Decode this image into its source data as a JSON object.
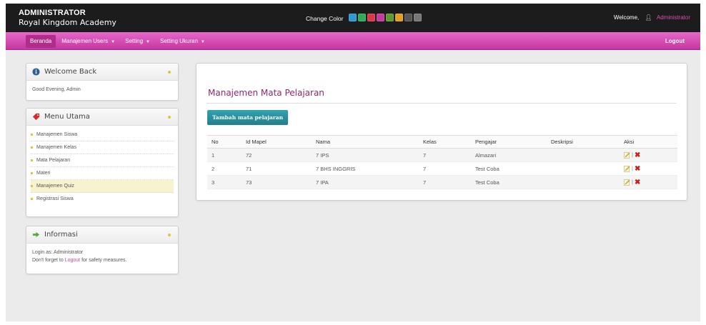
{
  "header": {
    "role": "ADMINISTRATOR",
    "school": "Royal Kingdom Academy",
    "change_color_label": "Change Color",
    "swatches": [
      "#2f9bd4",
      "#2fa95a",
      "#d93a4a",
      "#c53ba0",
      "#5e9a2f",
      "#e1a020",
      "#555555",
      "#777777"
    ],
    "welcome_label": "Welcome,",
    "user_name": "Administrator",
    "user_icon": "user-icon"
  },
  "nav": {
    "items": [
      {
        "label": "Beranda",
        "active": true,
        "dropdown": false
      },
      {
        "label": "Manajemen Users",
        "active": false,
        "dropdown": true
      },
      {
        "label": "Setting",
        "active": false,
        "dropdown": true
      },
      {
        "label": "Setting Ukuran",
        "active": false,
        "dropdown": true
      }
    ],
    "logout": "Logout"
  },
  "sidebar": {
    "welcome": {
      "title": "Welcome Back",
      "icon": "info-icon",
      "text": "Good Evening, Admin"
    },
    "menu": {
      "title": "Menu Utama",
      "icon": "tag-icon",
      "items": [
        {
          "label": "Manajemen Siswa"
        },
        {
          "label": "Manajemen Kelas"
        },
        {
          "label": "Mata Pelajaran"
        },
        {
          "label": "Materi"
        },
        {
          "label": "Manajemen Quiz"
        },
        {
          "label": "Registrasi Siswa"
        }
      ]
    },
    "info": {
      "title": "Informasi",
      "icon": "arrow-right-icon",
      "login_prefix": "Login as: Administrator",
      "logout_prefix": "Don't forget to",
      "logout_link": "Logout",
      "logout_suffix": "for safety measures."
    }
  },
  "main": {
    "title": "Manajemen Mata Pelajaran",
    "add_button": "Tambah mata pelajaran",
    "columns": [
      "No",
      "Id Mapel",
      "Nama",
      "Kelas",
      "Pengajar",
      "Deskripsi",
      "Aksi"
    ],
    "rows": [
      {
        "no": "1",
        "id": "72",
        "nama": "7 IPS",
        "kelas": "7",
        "pengajar": "Almazari",
        "deskripsi": ""
      },
      {
        "no": "2",
        "id": "71",
        "nama": "7 BHS INGGRIS",
        "kelas": "7",
        "pengajar": "Test Coba",
        "deskripsi": ""
      },
      {
        "no": "3",
        "id": "73",
        "nama": "7 IPA",
        "kelas": "7",
        "pengajar": "Test Coba",
        "deskripsi": ""
      }
    ],
    "action_sep": "|",
    "edit_icon": "edit-icon",
    "delete_icon": "delete-icon"
  }
}
